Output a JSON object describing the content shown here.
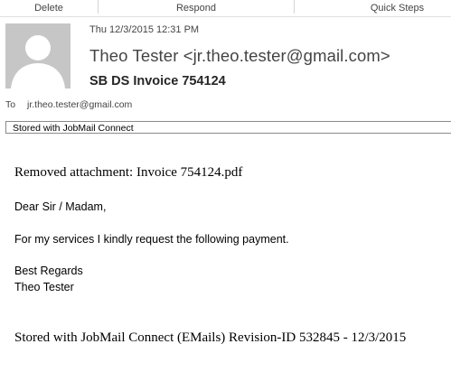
{
  "ribbon": {
    "groups": [
      "Delete",
      "Respond",
      "Quick Steps"
    ]
  },
  "message": {
    "date": "Thu 12/3/2015 12:31 PM",
    "sender": "Theo Tester <jr.theo.tester@gmail.com>",
    "subject": "SB DS Invoice 754124",
    "to_label": "To",
    "to_address": "jr.theo.tester@gmail.com",
    "stored_banner": "Stored with JobMail Connect"
  },
  "body": {
    "removed_attachment": "Removed attachment: Invoice 754124.pdf",
    "greeting": "Dear Sir / Madam,",
    "request": "For my services I kindly request the following payment.",
    "closing": "Best Regards",
    "signature": "Theo Tester",
    "footer": "Stored with JobMail Connect (EMails) Revision-ID 532845 - 12/3/2015"
  },
  "icons": {
    "avatar": "person-silhouette-icon"
  }
}
